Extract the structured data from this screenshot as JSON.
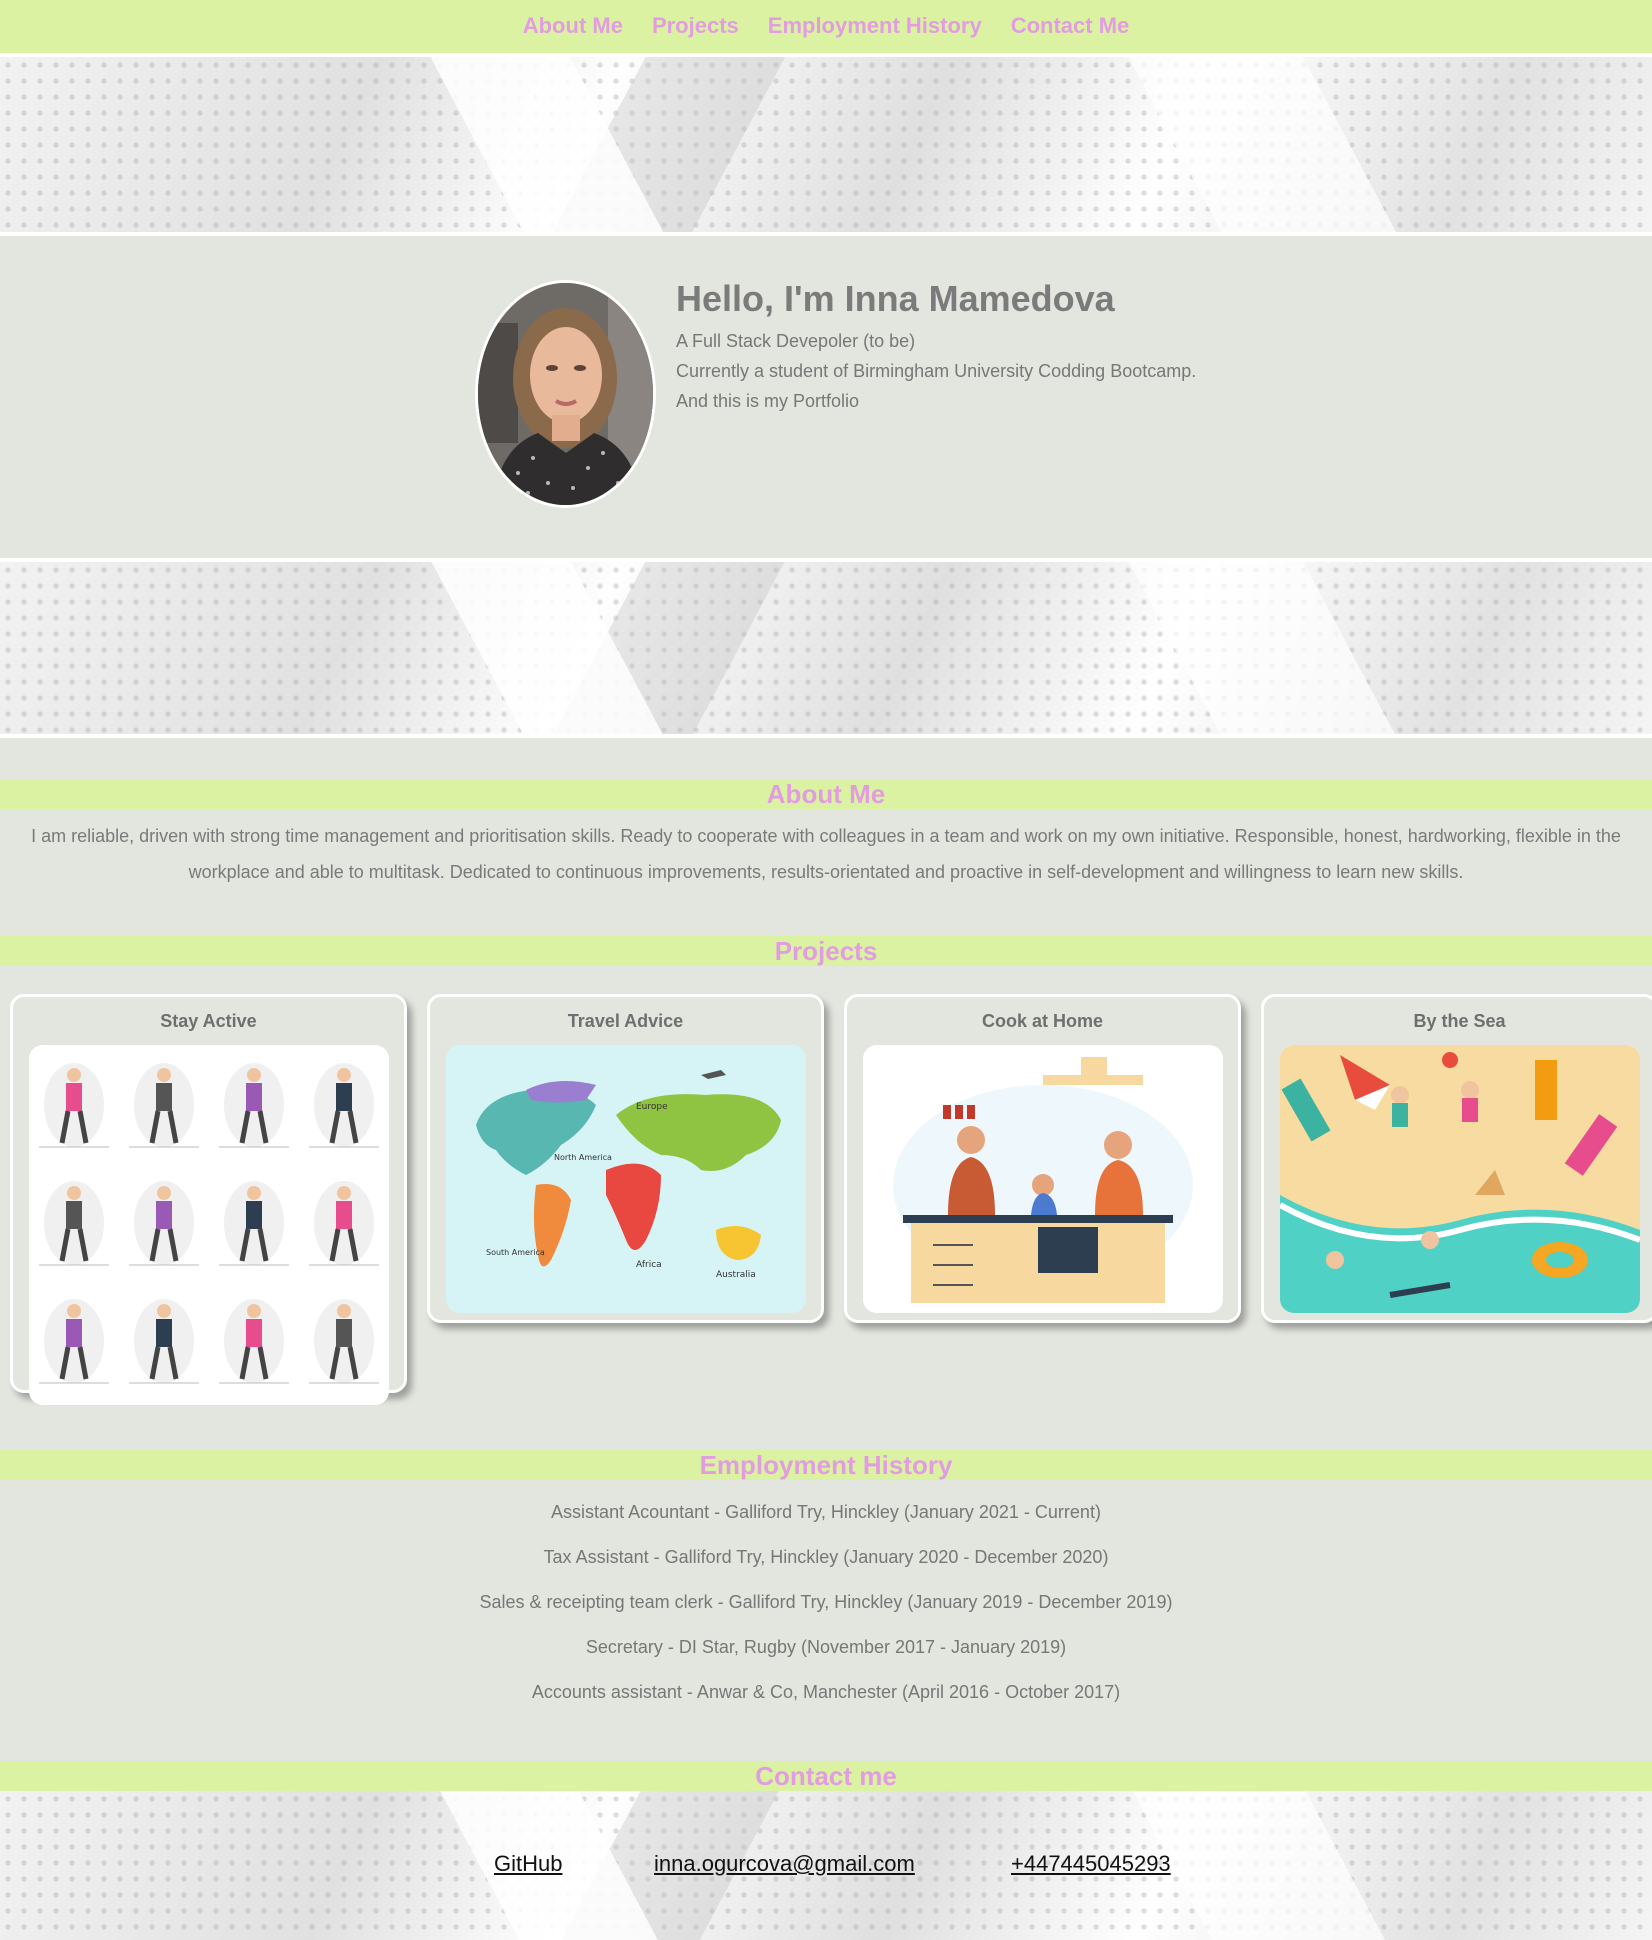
{
  "nav": {
    "items": [
      "About Me",
      "Projects",
      "Employment History",
      "Contact Me"
    ]
  },
  "hero": {
    "title": "Hello, I'm Inna Mamedova",
    "lines": [
      "A Full Stack Devepoler (to be)",
      "Currently a student of Birmingham University Codding Bootcamp.",
      "And this is my Portfolio"
    ]
  },
  "about": {
    "heading": "About Me",
    "text": "I am reliable, driven with strong time management and prioritisation skills. Ready to cooperate with colleagues in a team and work on my own initiative. Responsible, honest, hardworking, flexible in the workplace and able to multitask. Dedicated to continuous improvements, results-orientated and proactive in self-development and willingness to learn new skills."
  },
  "projects": {
    "heading": "Projects",
    "cards": [
      {
        "title": "Stay Active"
      },
      {
        "title": "Travel Advice"
      },
      {
        "title": "Cook at Home"
      },
      {
        "title": "By the Sea"
      }
    ]
  },
  "map_labels": [
    "Europe",
    "North America",
    "South America",
    "Africa",
    "Australia"
  ],
  "employment": {
    "heading": "Employment History",
    "jobs": [
      "Assistant Acountant - Galliford Try, Hinckley (January 2021 - Current)",
      "Tax Assistant - Galliford Try, Hinckley (January 2020 - December 2020)",
      "Sales & receipting team clerk - Galliford Try, Hinckley (January 2019 - December 2019)",
      "Secretary - DI Star, Rugby (November 2017 - January 2019)",
      "Accounts assistant - Anwar & Co, Manchester (April 2016 - October 2017)"
    ]
  },
  "contact": {
    "heading": "Contact me",
    "github": "GitHub",
    "email": "inna.ogurcova@gmail.com",
    "phone": "+447445045293"
  },
  "colors": {
    "accent_bar": "#dcf2a3",
    "accent_text": "#e29ce2",
    "page_bg": "#e3e5df"
  }
}
